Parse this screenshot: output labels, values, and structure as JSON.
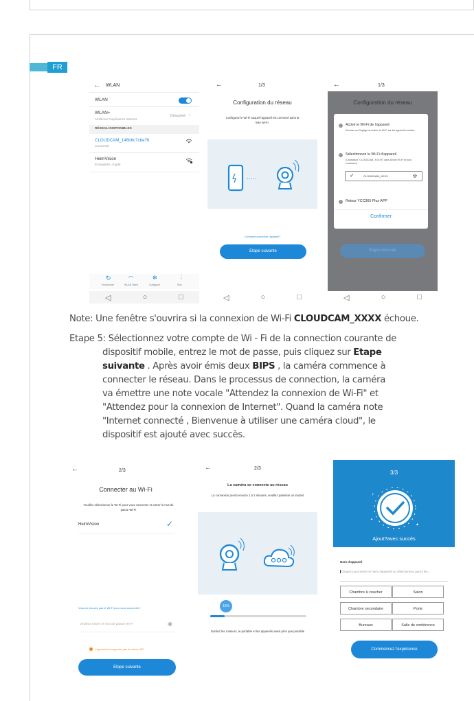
{
  "lang_badge": "FR",
  "screen1": {
    "title": "WLAN",
    "wlan_label": "WLAN",
    "wlan_plus_label": "WLAN+",
    "wlan_plus_sub": "Améliorer l'expérience Internet",
    "wlan_plus_state": "Désactivé",
    "section_header": "RÉSEAU DISPONIBLES",
    "networks": [
      {
        "name": "CLOUDCAM_146b6c7cbe76",
        "status": "Connecté"
      },
      {
        "name": "HeimVision",
        "status": "Enregistré, crypté"
      }
    ],
    "bottom_tabs": [
      "Rechercher",
      "WLAN Direct",
      "Configurer",
      "Plus"
    ]
  },
  "screen2": {
    "step": "1/3",
    "title": "Configuration du réseau",
    "subtitle": "Configurez le Wi-Fi auquel l'appareil est connecté dans la liste Wi-Fi.",
    "link": "Comment connecter l'appareil?",
    "button": "Etape suivante"
  },
  "screen3": {
    "step": "1/3",
    "title": "Configuration du réseau",
    "opt1_title": "Activé le Wi-Fi de l'appareil",
    "opt1_sub": "Accédez au Réglage et activez le Wi-Fi sur les appareils mobiles",
    "opt2_title": "Sélectionnez le Wi-Fi d'appareil",
    "opt2_sub": "(Choisissez \"CLOUDCAM_XXXXX\" dans la liste Wi-Fi et vous connectez)",
    "network": "CLOUDCAM_XXXX",
    "opt3_title": "Retour YCC365 Plus APP",
    "confirm": "Confirmer",
    "button": "Etape suivante"
  },
  "note": {
    "prefix": "Note: Une fenêtre s'ouvrira si la connexion de Wi-Fi ",
    "ssid": "CLOUDCAM_XXXX",
    "suffix": " échoue."
  },
  "step5": {
    "label": "Etape 5: ",
    "l1": "Sélectionnez votre compte de Wi - Fi de la connection courante de",
    "l2": "dispositif mobile, entrez le mot de passe, puis cliquez sur ",
    "l2b": "Etape",
    "l3b": "suivante",
    "l3": " . Après avoir émis deux ",
    "l3c": "BIPS",
    "l3d": " , la caméra commence à",
    "l4": "connecter le réseau. Dans le processus de connection, la caméra",
    "l5": "va émettre une note vocale \"Attendez la connexion de Wi-Fi\" et",
    "l6": "\"Attendez pour la connexion de Internet\". Quand la caméra note",
    "l7": "\"Internet connecté ,   Bienvenue à utiliser une caméra cloud\", le",
    "l8": "dispositif est ajouté avec succès."
  },
  "screen4": {
    "step": "2/3",
    "title": "Connecter au Wi-Fi",
    "subtitle": "Veuillez sélectionner le Wi-Fi pour vous connecter et entrer le mot de passe Wi-Fi",
    "network": "HeimVision",
    "link": "Vous ne trouvez pas le Wi-Fi pour vous connecter?",
    "password_placeholder": "Veuillez entrer le mot de passe Wi-Fi",
    "warning": "L'appareil ne supporte pas le réseau 5G",
    "button": "Etape suivante"
  },
  "screen5": {
    "step": "2/3",
    "title": "La caméra se connecte au réseau",
    "subtitle": "La connexion prend environ 1 à 2 minutes, veuillez patienter un instant",
    "progress_label": "15%",
    "progress": 0.15,
    "footer": "Gardez les routeurs, le portable et les appareils aussi près que possible"
  },
  "screen6": {
    "step": "3/3",
    "success": "Ajout?avec succès",
    "name_label": "Nom d'appareil",
    "name_placeholder": "Cliquez pour entrer le nom d'appareil ou sélectionnez parmi les...",
    "chips": [
      "Chambre à coucher",
      "Salon",
      "Chambre secondaire",
      "Porte",
      "Bureaux",
      "Salle de conférence"
    ],
    "button": "Commencez l'expérience"
  },
  "colors": {
    "accent": "#1e88d8",
    "header_blue": "#1e88cc",
    "badge": "#1f9fd4"
  }
}
